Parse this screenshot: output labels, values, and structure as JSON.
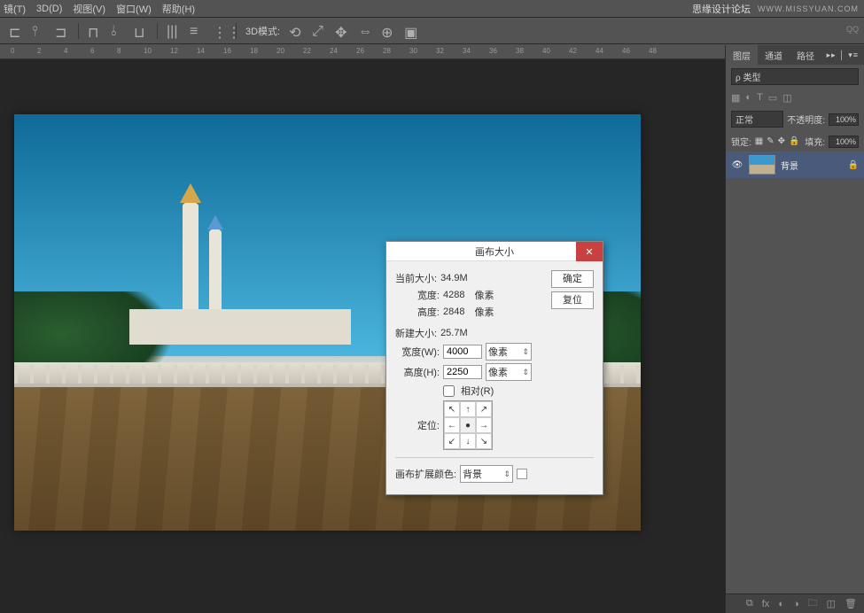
{
  "watermark": {
    "text": "思缘设计论坛",
    "url": "WWW.MISSYUAN.COM"
  },
  "qq_label": "QQ",
  "menu": {
    "filter": "镜(T)",
    "three_d": "3D(D)",
    "view": "视图(V)",
    "window": "窗口(W)",
    "help": "帮助(H)"
  },
  "toolbar": {
    "mode_label": "3D模式:"
  },
  "ruler": [
    "0",
    "2",
    "4",
    "6",
    "8",
    "10",
    "12",
    "14",
    "16",
    "18",
    "20",
    "22",
    "24",
    "26",
    "28",
    "30",
    "32",
    "34",
    "36",
    "38",
    "40",
    "42",
    "44",
    "46",
    "48"
  ],
  "panel": {
    "tabs": {
      "layers": "图层",
      "channels": "通道",
      "paths": "路径"
    },
    "kind": "ρ 类型",
    "blend": "正常",
    "opacity_label": "不透明度:",
    "opacity": "100%",
    "lock_label": "锁定:",
    "fill_label": "填充:",
    "fill": "100%",
    "layer_name": "背景"
  },
  "dialog": {
    "title": "画布大小",
    "current_label": "当前大小:",
    "current_size": "34.9M",
    "width_label": "宽度:",
    "current_width": "4288",
    "height_label": "高度:",
    "current_height": "2848",
    "unit_px": "像素",
    "new_label": "新建大小:",
    "new_size": "25.7M",
    "new_width_label": "宽度(W):",
    "new_width": "4000",
    "new_height_label": "高度(H):",
    "new_height": "2250",
    "relative_label": "相对(R)",
    "anchor_label": "定位:",
    "ext_label": "画布扩展颜色:",
    "ext_value": "背景",
    "ok": "确定",
    "reset": "复位"
  }
}
